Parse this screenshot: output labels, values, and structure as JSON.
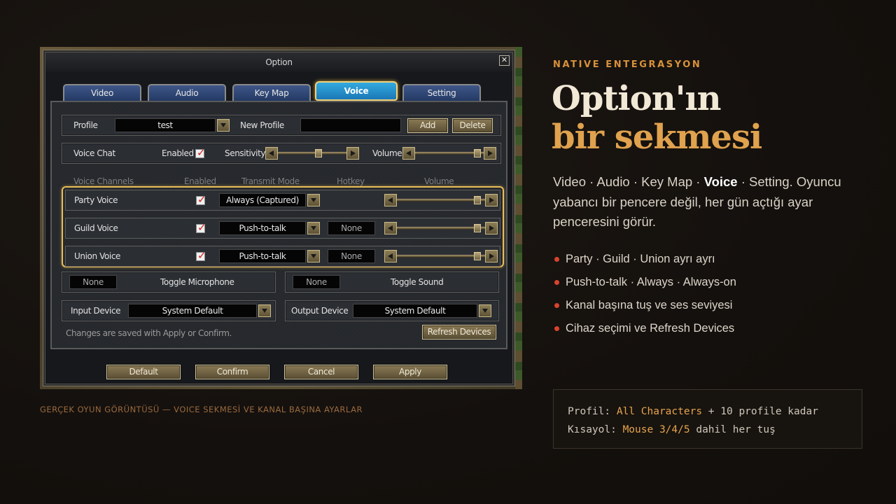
{
  "window": {
    "title": "Option",
    "close_glyph": "✕"
  },
  "tabs": [
    {
      "label": "Video",
      "active": false
    },
    {
      "label": "Audio",
      "active": false
    },
    {
      "label": "Key Map",
      "active": false
    },
    {
      "label": "Voice",
      "active": true
    },
    {
      "label": "Setting",
      "active": false
    }
  ],
  "profile_row": {
    "profile_label": "Profile",
    "profile_value": "test",
    "new_profile_label": "New Profile",
    "new_profile_value": "",
    "add_label": "Add",
    "delete_label": "Delete"
  },
  "voice_chat_row": {
    "label": "Voice Chat",
    "enabled_label": "Enabled",
    "enabled": true,
    "sensitivity_label": "Sensitivity",
    "sensitivity_level": 0.6,
    "volume_label": "Volume",
    "volume_level": 0.95
  },
  "channel_headers": {
    "channels": "Voice Channels",
    "enabled": "Enabled",
    "transmit": "Transmit Mode",
    "hotkey": "Hotkey",
    "volume": "Volume"
  },
  "channels": [
    {
      "name": "Party Voice",
      "enabled": true,
      "mode": "Always (Captured)",
      "hotkey": "",
      "volume_level": 0.95
    },
    {
      "name": "Guild Voice",
      "enabled": true,
      "mode": "Push-to-talk",
      "hotkey": "None",
      "volume_level": 0.95
    },
    {
      "name": "Union Voice",
      "enabled": true,
      "mode": "Push-to-talk",
      "hotkey": "None",
      "volume_level": 0.95
    }
  ],
  "toggles": {
    "mic_hotkey": "None",
    "mic_label": "Toggle Microphone",
    "sound_hotkey": "None",
    "sound_label": "Toggle Sound"
  },
  "devices": {
    "input_label": "Input Device",
    "input_value": "System Default",
    "output_label": "Output Device",
    "output_value": "System Default",
    "note": "Changes are saved with Apply or Confirm.",
    "refresh_label": "Refresh Devices"
  },
  "footer_buttons": {
    "default": "Default",
    "confirm": "Confirm",
    "cancel": "Cancel",
    "apply": "Apply"
  },
  "caption": "GERÇEK OYUN GÖRÜNTÜSÜ — VOICE SEKMESİ VE KANAL BAŞINA AYARLAR",
  "right": {
    "kicker": "NATIVE ENTEGRASYON",
    "headline_line1": "Option'ın",
    "headline_line2": "bir sekmesi",
    "intro_before": "Video · Audio · Key Map · ",
    "intro_bold": "Voice",
    "intro_after": " · Setting. Oyuncu yabancı bir pencere değil, her gün açtığı ayar penceresini görür.",
    "bullets": [
      "Party · Guild · Union ayrı ayrı",
      "Push-to-talk · Always · Always-on",
      "Kanal başına tuş ve ses seviyesi",
      "Cihaz seçimi ve Refresh Devices"
    ],
    "code": {
      "line1_key": "Profil:",
      "line1_value": "All Characters",
      "line1_rest": "+ 10 profile kadar",
      "line2_key": "Kısayol:",
      "line2_value": "Mouse 3/4/5",
      "line2_rest": "dahil her tuş"
    }
  },
  "colors": {
    "accent_orange": "#e0a24e",
    "active_tab_blue": "#33a9e0",
    "bullet_red": "#d9432e",
    "channel_highlight": "#e9bd5a"
  }
}
